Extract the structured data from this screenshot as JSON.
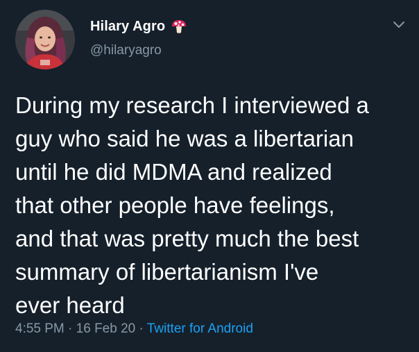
{
  "tweet": {
    "author": {
      "display_name": "Hilary Agro",
      "handle": "@hilaryagro",
      "name_emoji": "mushroom-icon"
    },
    "text": "During my research I interviewed a\nguy who said he was a libertarian\nuntil he did MDMA and realized\nthat other people have feelings,\nand that was pretty much the best\nsummary of libertarianism I've\never heard",
    "time": "4:55 PM",
    "separator": "·",
    "date": "16 Feb 20",
    "source": "Twitter for Android"
  },
  "icons": {
    "menu": "chevron-down-icon",
    "avatar": "avatar"
  },
  "colors": {
    "background": "#15202b",
    "text": "#ffffff",
    "secondary": "#8899a6",
    "link": "#1da1f2"
  }
}
